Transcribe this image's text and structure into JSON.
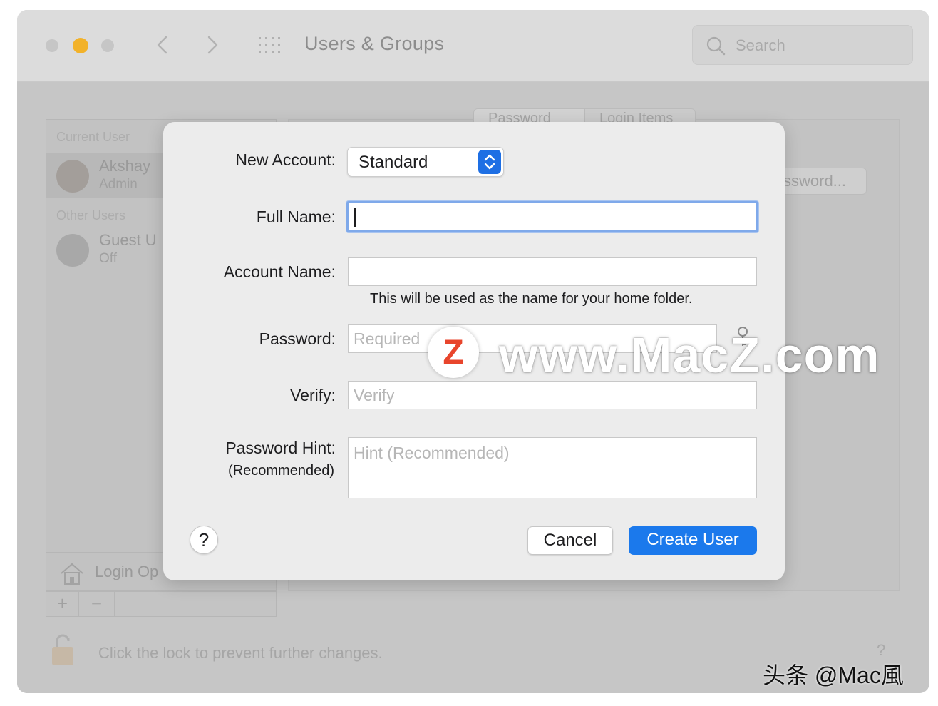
{
  "window": {
    "title": "Users & Groups",
    "search_placeholder": "Search"
  },
  "sidebar": {
    "current_user_header": "Current User",
    "current_user": {
      "name": "Akshay",
      "role": "Admin"
    },
    "other_users_header": "Other Users",
    "guest_user": {
      "name": "Guest U",
      "status": "Off"
    },
    "login_options_label": "Login Op",
    "add_label": "+",
    "remove_label": "−"
  },
  "main": {
    "tabs": [
      {
        "label": "Password"
      },
      {
        "label": "Login Items"
      }
    ],
    "change_password_label": "ssword..."
  },
  "footer": {
    "lock_text": "Click the lock to prevent further changes.",
    "help_label": "?"
  },
  "dialog": {
    "new_account_label": "New Account:",
    "account_type": "Standard",
    "full_name_label": "Full Name:",
    "full_name_value": "",
    "account_name_label": "Account Name:",
    "account_name_value": "",
    "account_name_help": "This will be used as the name for your home folder.",
    "password_label": "Password:",
    "password_placeholder": "Required",
    "verify_label": "Verify:",
    "verify_placeholder": "Verify",
    "hint_label": "Password Hint:",
    "hint_sublabel": "(Recommended)",
    "hint_placeholder": "Hint (Recommended)",
    "help_button": "?",
    "cancel_label": "Cancel",
    "create_label": "Create User"
  },
  "watermarks": {
    "site_text": "www.MacZ.com",
    "logo_letter": "Z",
    "bottom_text": "头条 @Mac風"
  },
  "colors": {
    "accent": "#1b79ec",
    "minimize_yellow": "#f2b22a",
    "focus_ring": "#7fa9ea",
    "logo_red": "#e8452c"
  }
}
